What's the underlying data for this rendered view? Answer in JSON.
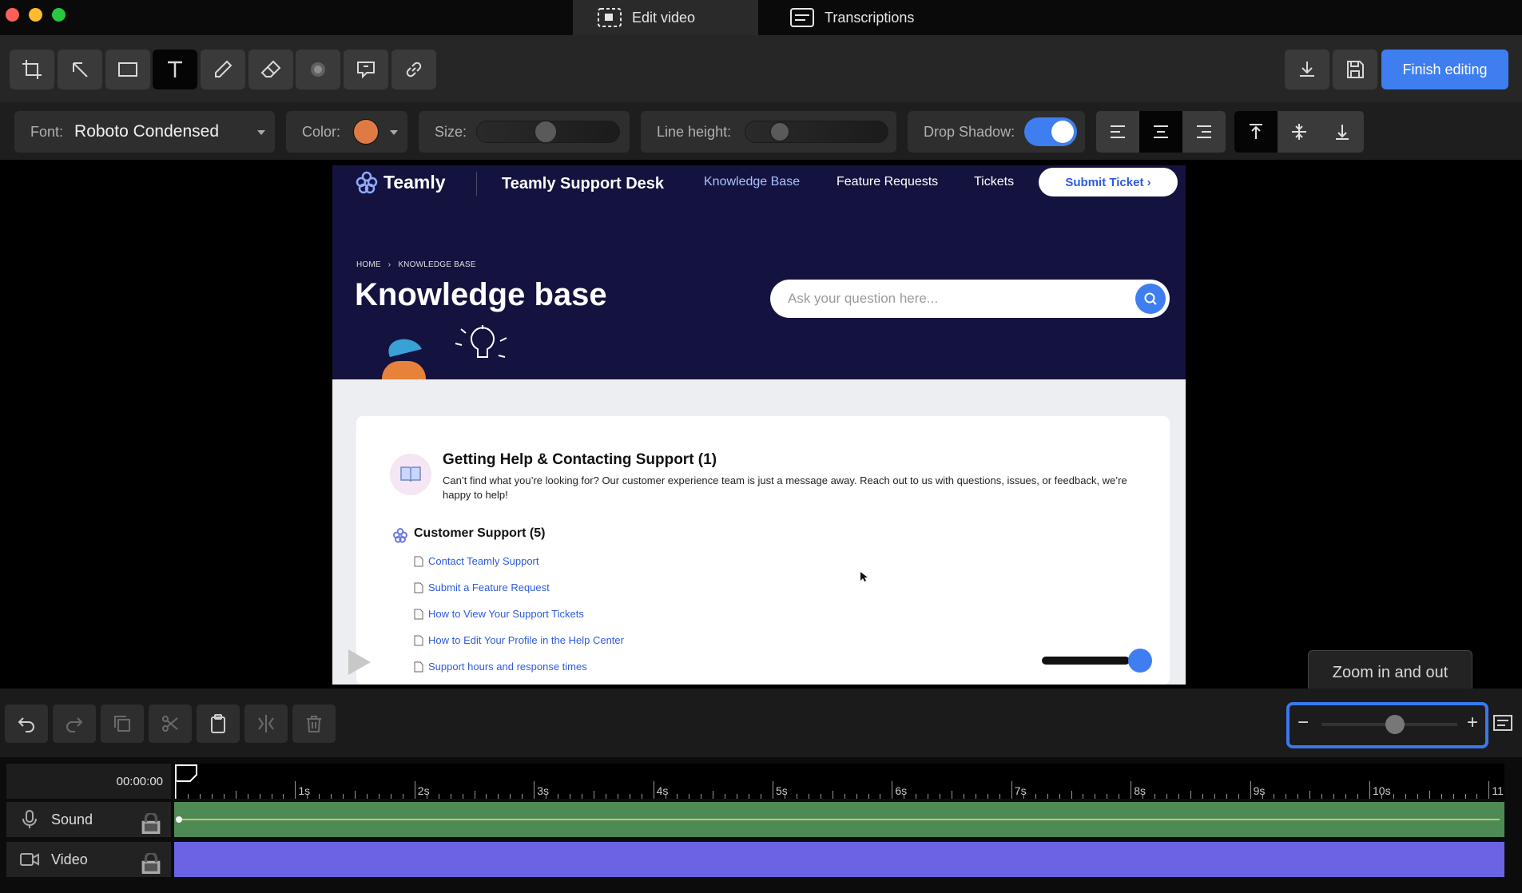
{
  "window": {
    "tabs": [
      {
        "label": "Edit video",
        "icon": "edit-video-icon",
        "active": true
      },
      {
        "label": "Transcriptions",
        "icon": "transcript-icon",
        "active": false
      }
    ]
  },
  "toolbar": {
    "tools": [
      "crop-icon",
      "arrow-icon",
      "rectangle-icon",
      "text-icon",
      "pen-icon",
      "eraser-icon",
      "blur-icon",
      "speech-bubble-icon",
      "link-icon"
    ],
    "active_tool": "text-icon",
    "finish_label": "Finish editing"
  },
  "properties": {
    "font_label": "Font:",
    "font_value": "Roboto Condensed",
    "color_label": "Color:",
    "color_value": "#e07a45",
    "size_label": "Size:",
    "size_level": 0.48,
    "line_height_label": "Line height:",
    "line_height_level": 0.2,
    "drop_shadow_label": "Drop Shadow:",
    "drop_shadow_on": true,
    "text_align_active": "center",
    "vertical_align_active": "top"
  },
  "preview": {
    "nav": {
      "brand": "Teamly",
      "site_title": "Teamly Support Desk",
      "links": [
        "Knowledge Base",
        "Feature Requests",
        "Tickets"
      ],
      "active_link": "Knowledge Base",
      "cta": "Submit Ticket ›"
    },
    "breadcrumb": {
      "home": "HOME",
      "sep": "›",
      "current": "KNOWLEDGE BASE"
    },
    "title": "Knowledge base",
    "search_placeholder": "Ask your question here...",
    "section1": {
      "title": "Getting Help & Contacting Support (1)",
      "description": "Can’t find what you’re looking for? Our customer experience team is just a message away. Reach out to us with questions, issues, or feedback, we’re happy to help!"
    },
    "section2": {
      "title": "Customer Support (5)",
      "articles": [
        "Contact Teamly Support",
        "Submit a Feature Request",
        "How to View Your Support Tickets",
        "How to Edit Your Profile in the Help Center",
        "Support hours and response times"
      ]
    }
  },
  "zoom": {
    "tooltip": "Zoom in and out",
    "minus": "−",
    "plus": "+",
    "level": 0.55
  },
  "timeline": {
    "time": "00:00:00",
    "ruler_labels": [
      "1s",
      "2s",
      "3s",
      "4s",
      "5s",
      "6s",
      "7s",
      "8s",
      "9s",
      "10s",
      "11"
    ],
    "tracks": [
      {
        "label": "Sound",
        "icon": "microphone-icon"
      },
      {
        "label": "Video",
        "icon": "video-camera-icon"
      }
    ]
  }
}
